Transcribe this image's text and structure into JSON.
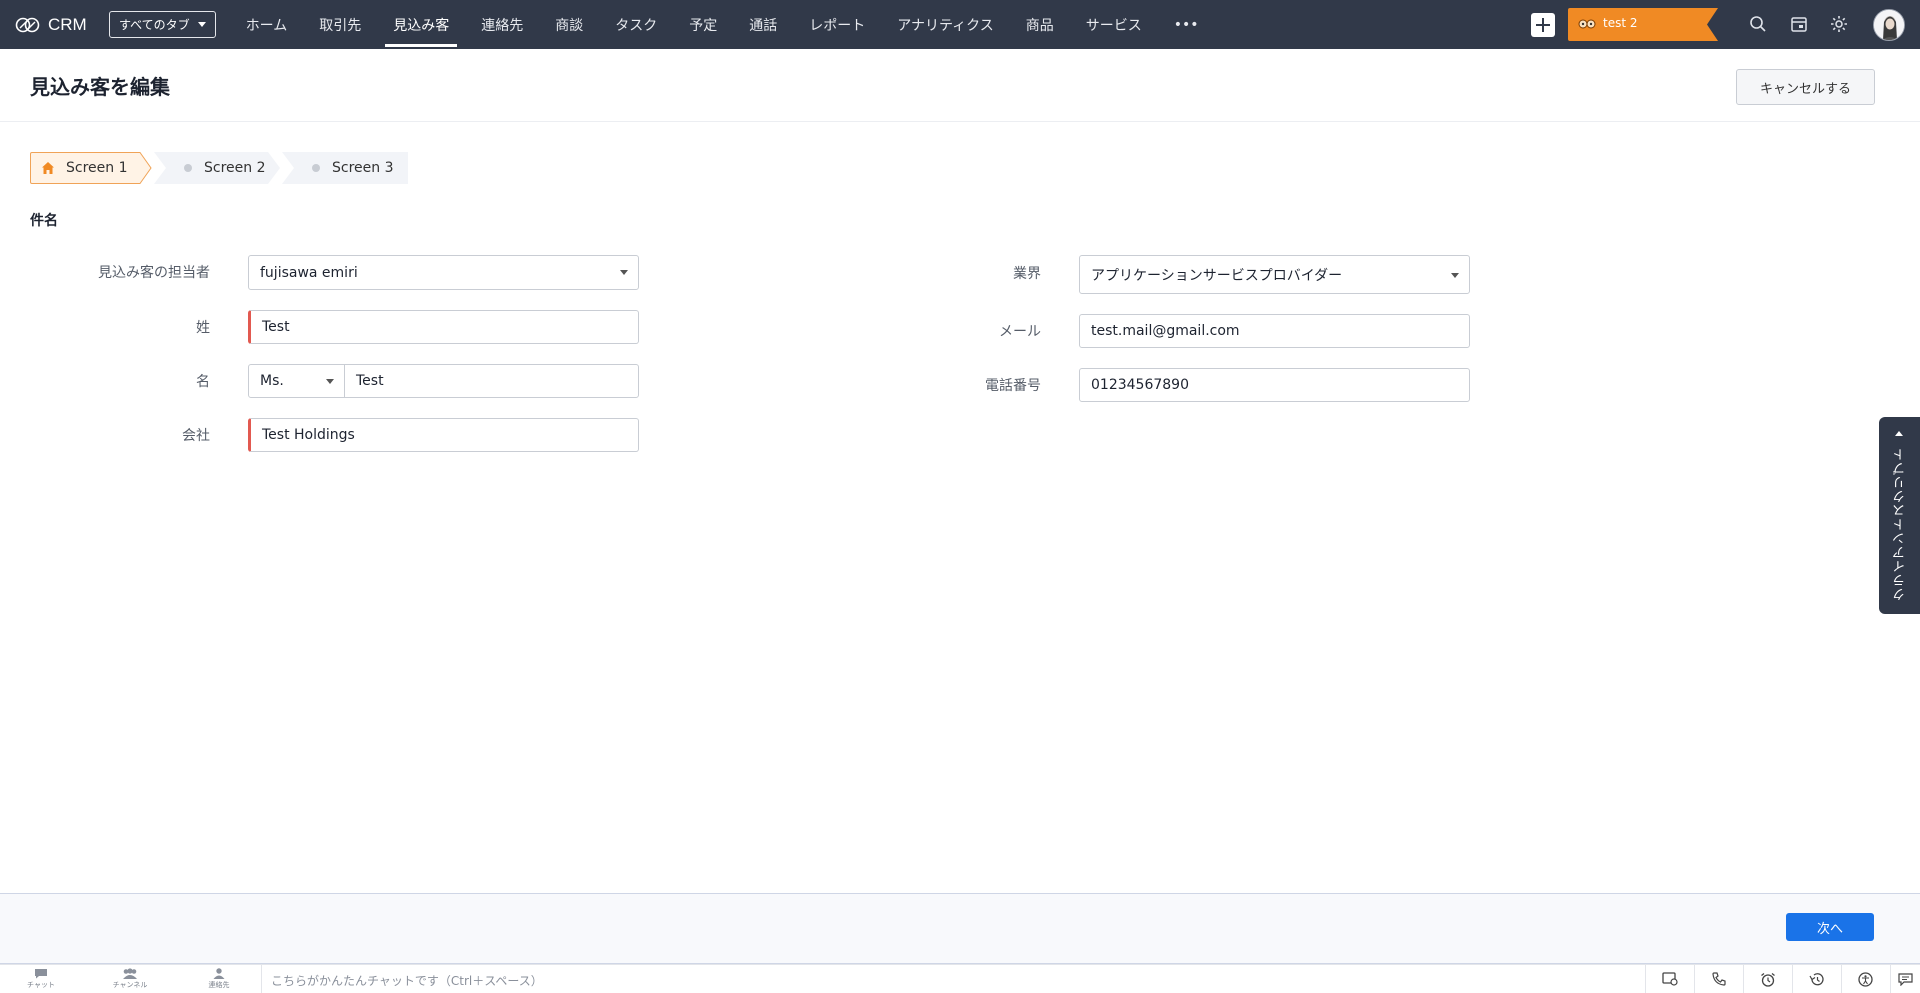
{
  "app": {
    "name": "CRM"
  },
  "nav": {
    "all_tabs": "すべてのタブ",
    "tabs": [
      "ホーム",
      "取引先",
      "見込み客",
      "連絡先",
      "商談",
      "タスク",
      "予定",
      "通話",
      "レポート",
      "アナリティクス",
      "商品",
      "サービス"
    ],
    "active_tab": "見込み客",
    "more": "•••",
    "promo_label": "test 2",
    "promo_color": "#f08a24",
    "bg_color": "#313949"
  },
  "header": {
    "title": "見込み客を編集",
    "cancel_label": "キャンセルする"
  },
  "steps": [
    "Screen 1",
    "Screen 2",
    "Screen 3"
  ],
  "section": {
    "title": "件名"
  },
  "form": {
    "owner": {
      "label": "見込み客の担当者",
      "value": "fujisawa emiri"
    },
    "last_name": {
      "label": "姓",
      "value": "Test"
    },
    "first_name": {
      "label": "名",
      "salutation": "Ms.",
      "value": "Test"
    },
    "company": {
      "label": "会社",
      "value": "Test Holdings"
    },
    "industry": {
      "label": "業界",
      "value": "アプリケーションサービスプロバイダー"
    },
    "email": {
      "label": "メール",
      "value": "test.mail@gmail.com"
    },
    "phone": {
      "label": "電話番号",
      "value": "01234567890"
    }
  },
  "side_tab": {
    "label": "クライアントスクリプト"
  },
  "footer": {
    "next_label": "次へ",
    "accent": "#1a73e8"
  },
  "chatbar": {
    "items": [
      "チャット",
      "チャンネル",
      "連絡先"
    ],
    "placeholder": "こちらがかんたんチャットです（Ctrl＋スペース）"
  }
}
